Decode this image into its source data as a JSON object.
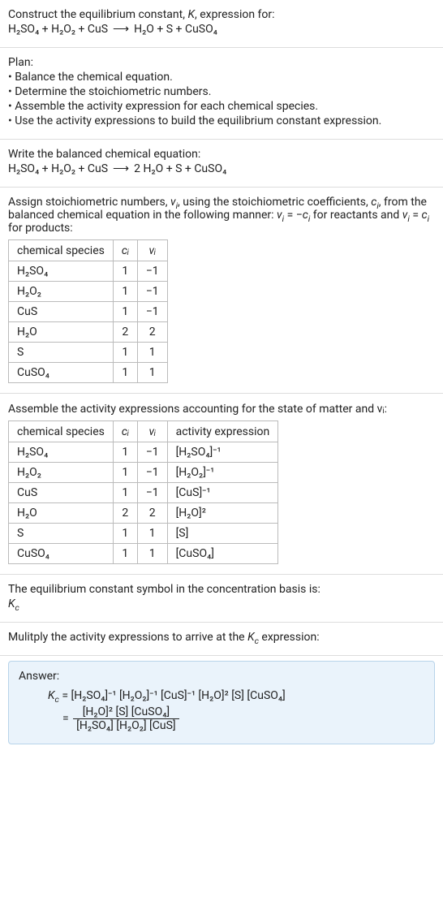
{
  "heading": {
    "title_prefix": "Construct the equilibrium constant, ",
    "title_k": "K",
    "title_suffix": ", expression for:"
  },
  "equations": {
    "reactant1": "H₂SO₄",
    "plus": " + ",
    "reactant2": "H₂O₂",
    "reactant3": "CuS",
    "arrow": "⟶",
    "product1": "H₂O",
    "product2": "S",
    "product3": "CuSO₄",
    "balanced_coeff": "2 "
  },
  "plan": {
    "heading": "Plan:",
    "items": [
      "• Balance the chemical equation.",
      "• Determine the stoichiometric numbers.",
      "• Assemble the activity expression for each chemical species.",
      "• Use the activity expressions to build the equilibrium constant expression."
    ]
  },
  "balance_heading": "Write the balanced chemical equation:",
  "assign": {
    "text1": "Assign stoichiometric numbers, ",
    "nu": "ν",
    "sub_i": "i",
    "text2": ", using the stoichiometric coefficients, ",
    "c": "c",
    "text3": ", from the balanced chemical equation in the following manner: ",
    "eq1_lhs": "ν",
    "eq1_mid": " = −",
    "eq1_c": "c",
    "eq1_tail": " for reactants and ",
    "eq2_lhs": "ν",
    "eq2_mid": " = ",
    "eq2_c": "c",
    "eq2_tail": " for products:"
  },
  "table1": {
    "h1": "chemical species",
    "h2": "cᵢ",
    "h3": "νᵢ",
    "rows": [
      {
        "sp": "H₂SO₄",
        "c": "1",
        "v": "−1"
      },
      {
        "sp": "H₂O₂",
        "c": "1",
        "v": "−1"
      },
      {
        "sp": "CuS",
        "c": "1",
        "v": "−1"
      },
      {
        "sp": "H₂O",
        "c": "2",
        "v": "2"
      },
      {
        "sp": "S",
        "c": "1",
        "v": "1"
      },
      {
        "sp": "CuSO₄",
        "c": "1",
        "v": "1"
      }
    ]
  },
  "assemble_heading": "Assemble the activity expressions accounting for the state of matter and νᵢ:",
  "table2": {
    "h1": "chemical species",
    "h2": "cᵢ",
    "h3": "νᵢ",
    "h4": "activity expression",
    "rows": [
      {
        "sp": "H₂SO₄",
        "c": "1",
        "v": "−1",
        "a": "[H₂SO₄]⁻¹"
      },
      {
        "sp": "H₂O₂",
        "c": "1",
        "v": "−1",
        "a": "[H₂O₂]⁻¹"
      },
      {
        "sp": "CuS",
        "c": "1",
        "v": "−1",
        "a": "[CuS]⁻¹"
      },
      {
        "sp": "H₂O",
        "c": "2",
        "v": "2",
        "a": "[H₂O]²"
      },
      {
        "sp": "S",
        "c": "1",
        "v": "1",
        "a": "[S]"
      },
      {
        "sp": "CuSO₄",
        "c": "1",
        "v": "1",
        "a": "[CuSO₄]"
      }
    ]
  },
  "symbol_text": "The equilibrium constant symbol in the concentration basis is:",
  "symbol_k": "K",
  "symbol_sub": "c",
  "multiply_text_prefix": "Mulitply the activity expressions to arrive at the ",
  "multiply_text_suffix": " expression:",
  "answer": {
    "label": "Answer:",
    "lhs_k": "K",
    "lhs_sub": "c",
    "eq": " = ",
    "prod": "[H₂SO₄]⁻¹ [H₂O₂]⁻¹ [CuS]⁻¹ [H₂O]² [S] [CuSO₄]",
    "frac_num": "[H₂O]² [S] [CuSO₄]",
    "frac_den": "[H₂SO₄] [H₂O₂] [CuS]"
  }
}
